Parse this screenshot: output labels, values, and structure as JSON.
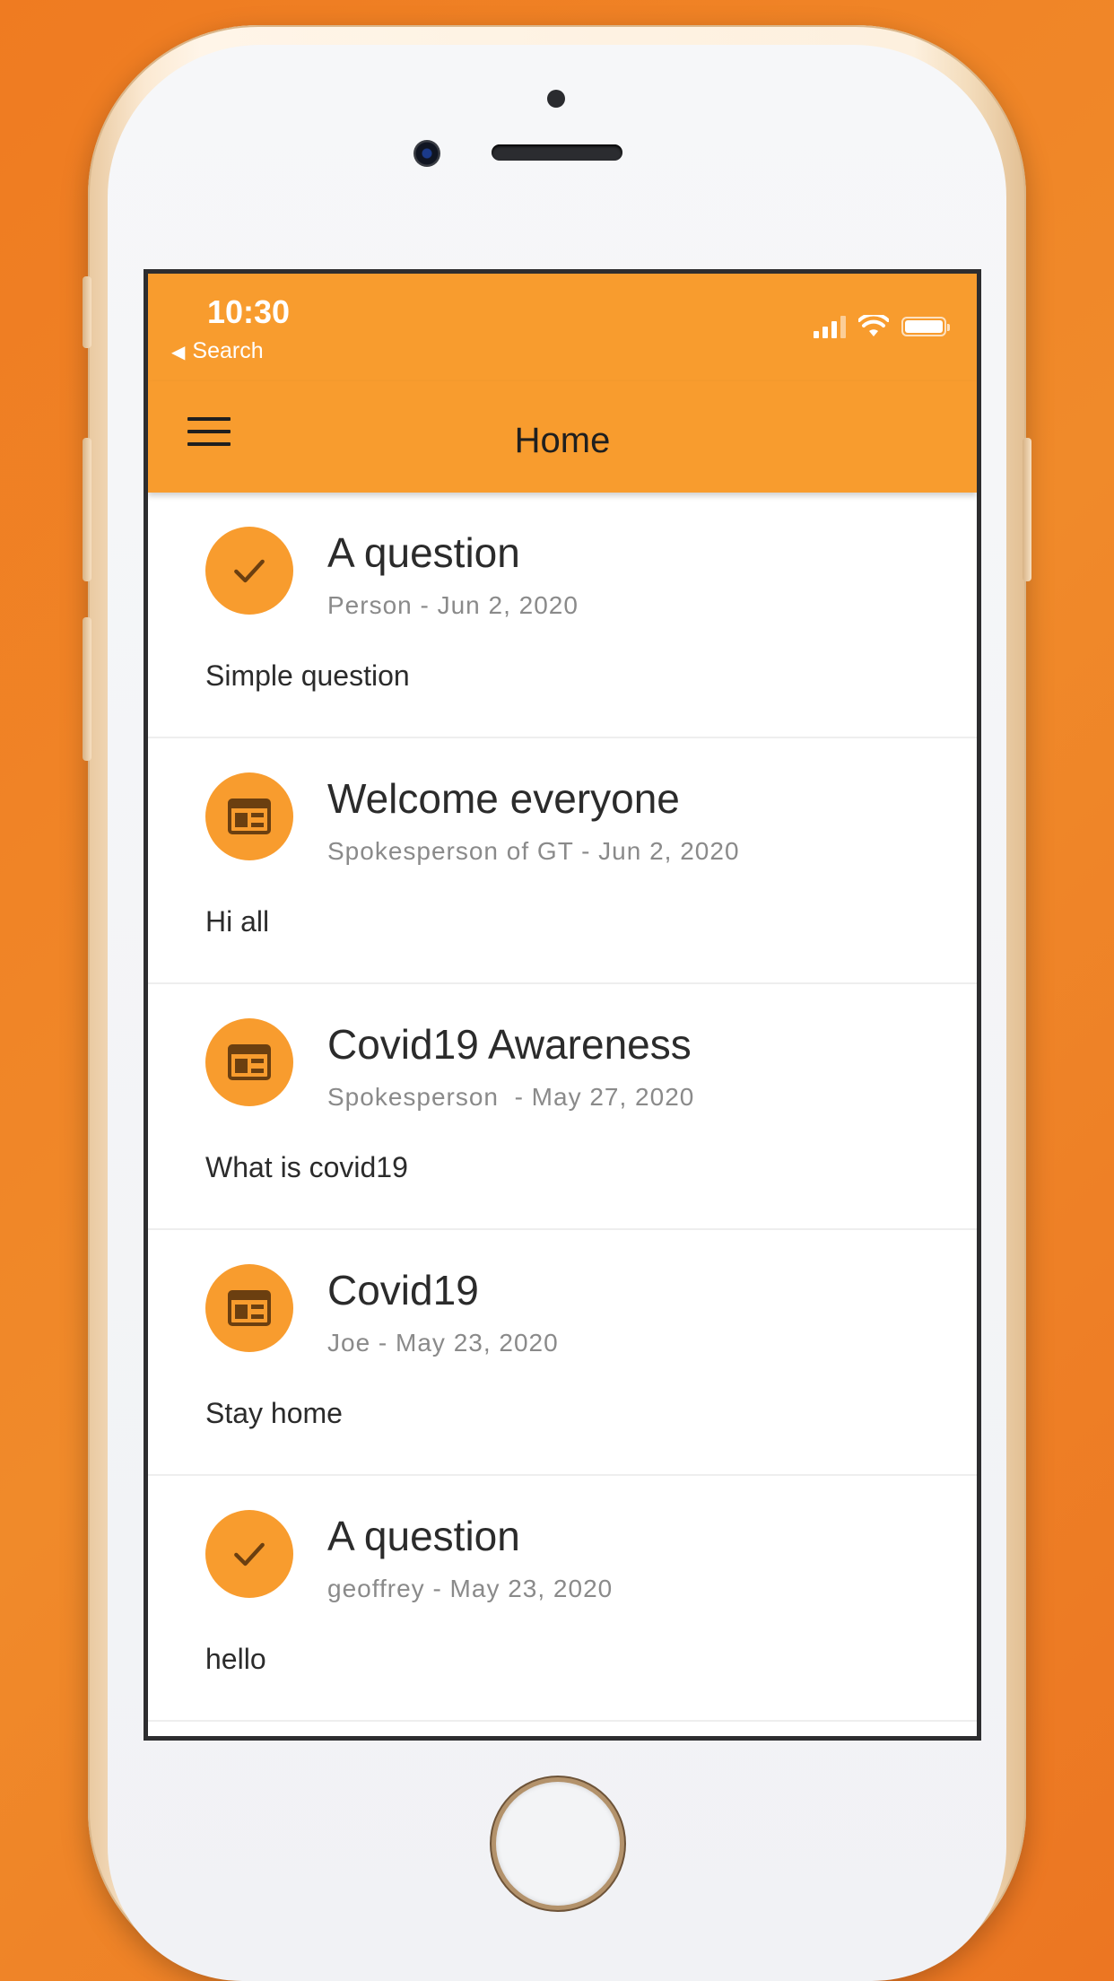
{
  "status_bar": {
    "time": "10:30",
    "back_label": "Search"
  },
  "app_bar": {
    "title": "Home"
  },
  "colors": {
    "accent": "#f89c2e",
    "background": "#ef7b21"
  },
  "posts": [
    {
      "icon": "check-icon",
      "title": "A question",
      "meta": "Person - Jun 2, 2020",
      "body": "Simple question"
    },
    {
      "icon": "article-icon",
      "title": "Welcome everyone",
      "meta": "Spokesperson of GT - Jun 2, 2020",
      "body": "Hi all"
    },
    {
      "icon": "article-icon",
      "title": "Covid19 Awareness",
      "meta": "Spokesperson  - May 27, 2020",
      "body": "What is covid19"
    },
    {
      "icon": "article-icon",
      "title": "Covid19",
      "meta": "Joe - May 23, 2020",
      "body": "Stay home"
    },
    {
      "icon": "check-icon",
      "title": "A question",
      "meta": "geoffrey - May 23, 2020",
      "body": "hello"
    }
  ]
}
